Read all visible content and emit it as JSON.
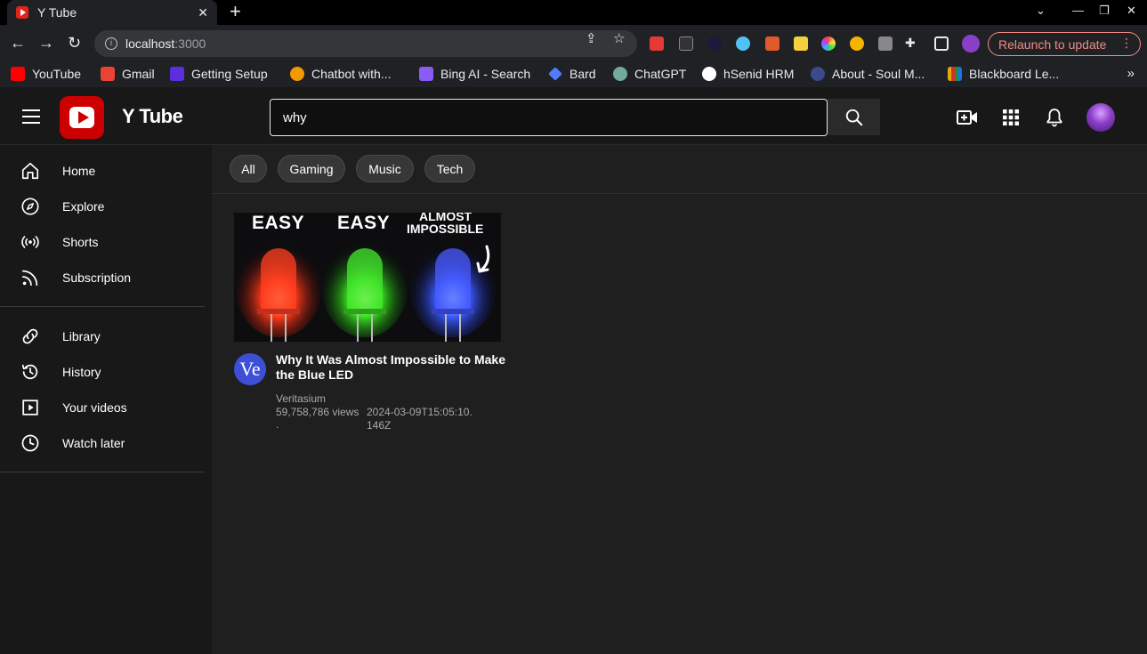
{
  "browser": {
    "tab_title": "Y Tube",
    "url_host": "localhost",
    "url_port": ":3000",
    "relaunch_label": "Relaunch to update",
    "bookmarks": [
      {
        "label": "YouTube",
        "color": "#ff0000"
      },
      {
        "label": "Gmail",
        "color": "#ea4335"
      },
      {
        "label": "Getting Setup",
        "color": "#5f2de0"
      },
      {
        "label": "Chatbot with...",
        "color": "#f29900"
      },
      {
        "label": "Bing AI - Search",
        "color": "#8a5cf6"
      },
      {
        "label": "Bard",
        "color": "#4f7cf7"
      },
      {
        "label": "ChatGPT",
        "color": "#74aa9c"
      },
      {
        "label": "hSenid HRM",
        "color": "#ffffff"
      },
      {
        "label": "About - Soul M...",
        "color": "#3c4a8c"
      },
      {
        "label": "Blackboard Le...",
        "color": "#e6a800"
      }
    ]
  },
  "app": {
    "brand": "Y Tube",
    "search_value": "why",
    "sidebar": {
      "items": [
        {
          "label": "Home",
          "icon": "home-icon"
        },
        {
          "label": "Explore",
          "icon": "compass-icon"
        },
        {
          "label": "Shorts",
          "icon": "broadcast-icon"
        },
        {
          "label": "Subscription",
          "icon": "rss-icon"
        },
        {
          "label": "Library",
          "icon": "library-icon"
        },
        {
          "label": "History",
          "icon": "history-icon"
        },
        {
          "label": "Your videos",
          "icon": "play-square-icon"
        },
        {
          "label": "Watch later",
          "icon": "clock-icon"
        }
      ]
    },
    "chips": [
      "All",
      "Gaming",
      "Music",
      "Tech"
    ],
    "videos": [
      {
        "title": "Why It Was Almost Impossible to Make the Blue LED",
        "channel": "Veritasium",
        "channel_initials": "Ve",
        "views": "59,758,786 views",
        "separator": ".",
        "date": "2024-03-09T15:05:10.146Z",
        "thumbnail_text": {
          "left": "EASY",
          "middle": "EASY",
          "right_top": "ALMOST",
          "right_bottom": "IMPOSSIBLE"
        }
      }
    ]
  }
}
